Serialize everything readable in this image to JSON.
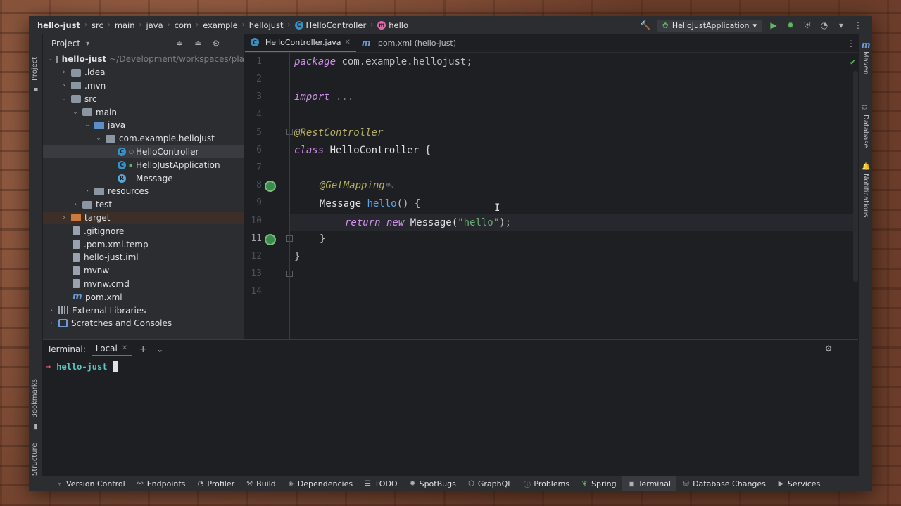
{
  "navbar": {
    "breadcrumbs": [
      "hello-just",
      "src",
      "main",
      "java",
      "com",
      "example",
      "hellojust",
      "HelloController",
      "hello"
    ],
    "run_config": "HelloJustApplication"
  },
  "project": {
    "title": "Project",
    "root_name": "hello-just",
    "root_path": "~/Development/workspaces/pla",
    "items": {
      "idea": ".idea",
      "mvn": ".mvn",
      "src": "src",
      "main": "main",
      "java": "java",
      "pkg": "com.example.hellojust",
      "hello_controller": "HelloController",
      "hello_app": "HelloJustApplication",
      "message": "Message",
      "resources": "resources",
      "test": "test",
      "target": "target",
      "gitignore": ".gitignore",
      "pom_temp": ".pom.xml.temp",
      "iml": "hello-just.iml",
      "mvnw": "mvnw",
      "mvnw_cmd": "mvnw.cmd",
      "pom": "pom.xml",
      "ext_libs": "External Libraries",
      "scratches": "Scratches and Consoles"
    }
  },
  "editor": {
    "tabs": [
      {
        "label": "HelloController.java"
      },
      {
        "label": "pom.xml (hello-just)"
      }
    ],
    "line_numbers": [
      "1",
      "2",
      "3",
      "4",
      "5",
      "6",
      "7",
      "8",
      "9",
      "10",
      "11",
      "12",
      "13",
      "14"
    ],
    "code": {
      "l1_kw": "package",
      "l1_rest": " com.example.hellojust;",
      "l3_kw": "import",
      "l3_rest": " ...",
      "l6_ann": "@RestController",
      "l7_kw": "class",
      "l7_rest": " HelloController {",
      "l9_ann": "@GetMapping",
      "l10_type": "Message ",
      "l10_fn": "hello",
      "l10_rest": "() {",
      "l11_kw1": "return",
      "l11_kw2": " new",
      "l11_cls": " Message(",
      "l11_str": "\"hello\"",
      "l11_end": ");",
      "l12": "}",
      "l13": "}"
    }
  },
  "terminal": {
    "title": "Terminal:",
    "tab": "Local",
    "prompt_dir": "hello-just"
  },
  "sidebars": {
    "left_top": "Project",
    "left_bookmarks": "Bookmarks",
    "left_structure": "Structure",
    "right_maven": "Maven",
    "right_database": "Database",
    "right_notifications": "Notifications"
  },
  "statusbar": {
    "items": [
      "Version Control",
      "Endpoints",
      "Profiler",
      "Build",
      "Dependencies",
      "TODO",
      "SpotBugs",
      "GraphQL",
      "Problems",
      "Spring",
      "Terminal",
      "Database Changes",
      "Services"
    ]
  }
}
